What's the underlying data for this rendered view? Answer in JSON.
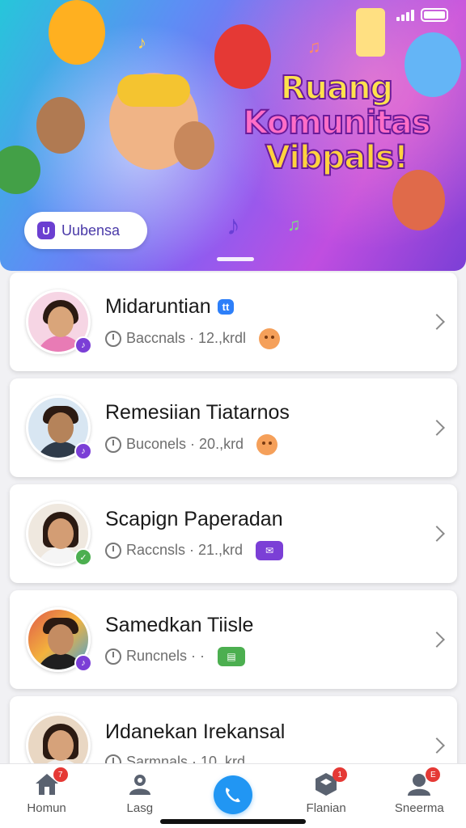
{
  "hero": {
    "title_lines": [
      "Ruang",
      "Komunitas",
      "Vibpals!"
    ],
    "chip_label": "Uubensa",
    "chip_icon": "u-logo-icon"
  },
  "list": [
    {
      "title": "Midaruntian",
      "tag": "tt",
      "meta": "Baccnals · 12.,krdl",
      "extra": "emoji-face",
      "badge_color": "#7b3fd6"
    },
    {
      "title": "Remesiian Tiatarnos",
      "tag": "",
      "meta": "Buconels · 20.,krd",
      "extra": "emoji-face",
      "badge_color": "#7b3fd6"
    },
    {
      "title": "Scapign Paperadan",
      "tag": "",
      "meta": "Raccnsls · 21.,krd",
      "extra": "purple-chat-icon",
      "badge_color": "#4caf50"
    },
    {
      "title": "Samedkan Tiisle",
      "tag": "",
      "meta": "Runcnels · ·",
      "extra": "green-chat-icon",
      "badge_color": "#7b3fd6"
    },
    {
      "title": "Иdanekan Irekansal",
      "tag": "",
      "meta": "Sarmnals · 10,.krd",
      "extra": "",
      "badge_color": "#7b3fd6"
    }
  ],
  "tabs": [
    {
      "label": "Homun",
      "icon": "home-icon",
      "badge": "7"
    },
    {
      "label": "Lasg",
      "icon": "people-icon",
      "badge": ""
    },
    {
      "label": "",
      "icon": "phone-icon",
      "badge": ""
    },
    {
      "label": "Flanian",
      "icon": "cube-icon",
      "badge": "1"
    },
    {
      "label": "Sneerma",
      "icon": "profile-icon",
      "badge": "E"
    }
  ]
}
